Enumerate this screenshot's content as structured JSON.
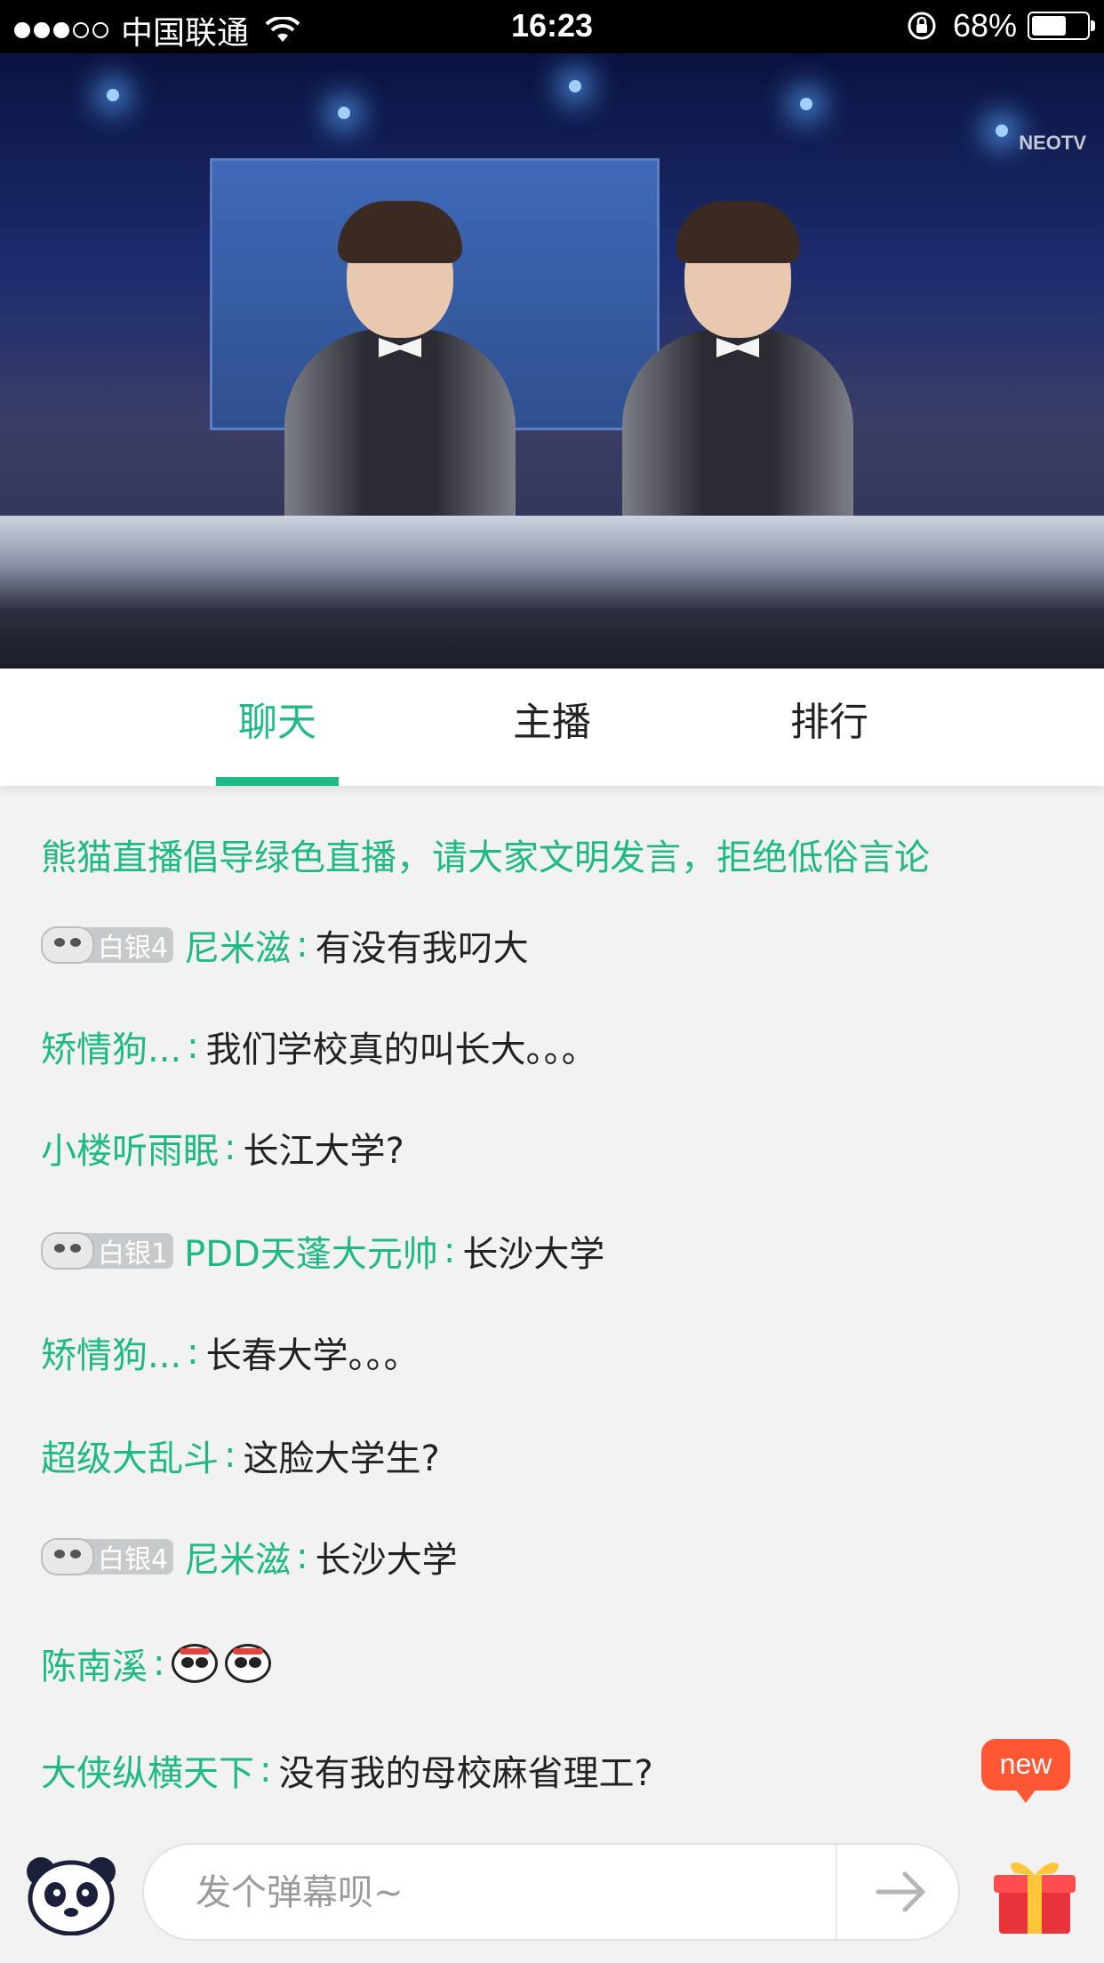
{
  "status_bar": {
    "carrier": "中国联通",
    "time": "16:23",
    "battery_percent": "68%",
    "battery_level": 0.68,
    "signal_bars_filled": 3,
    "signal_bars_total": 5
  },
  "video": {
    "watermark": "NEOTV"
  },
  "tabs": [
    {
      "label": "聊天",
      "active": true
    },
    {
      "label": "主播",
      "active": false
    },
    {
      "label": "排行",
      "active": false
    }
  ],
  "chat": {
    "notice": "熊猫直播倡导绿色直播，请大家文明发言，拒绝低俗言论",
    "separator": ":",
    "messages": [
      {
        "badge": "白银4",
        "user": "尼米滋",
        "text": "有没有我叼大"
      },
      {
        "badge": "",
        "user": "矫情狗...",
        "text": "我们学校真的叫长大。。。"
      },
      {
        "badge": "",
        "user": "小楼听雨眠",
        "text": "长江大学?"
      },
      {
        "badge": "白银1",
        "user": "PDD天蓬大元帅",
        "text": "长沙大学"
      },
      {
        "badge": "",
        "user": "矫情狗...",
        "text": "长春大学。。。"
      },
      {
        "badge": "",
        "user": "超级大乱斗",
        "text": "这脸大学生?"
      },
      {
        "badge": "白银4",
        "user": "尼米滋",
        "text": "长沙大学"
      },
      {
        "badge": "",
        "user": "陈南溪",
        "text": ""
      },
      {
        "badge": "",
        "user": "大侠纵横天下",
        "text": "没有我的母校麻省理工?"
      }
    ],
    "new_badge": "new"
  },
  "input_bar": {
    "placeholder": "发个弹幕呗~",
    "value": ""
  },
  "colors": {
    "accent": "#1fb887",
    "new_badge": "#ff5733",
    "badge_bg": "#c7cacd"
  },
  "icons": [
    "wifi-icon",
    "orientation-lock-icon",
    "battery-icon",
    "panda-emoji-icon",
    "panda-avatar-icon",
    "send-arrow-icon",
    "gift-icon"
  ]
}
